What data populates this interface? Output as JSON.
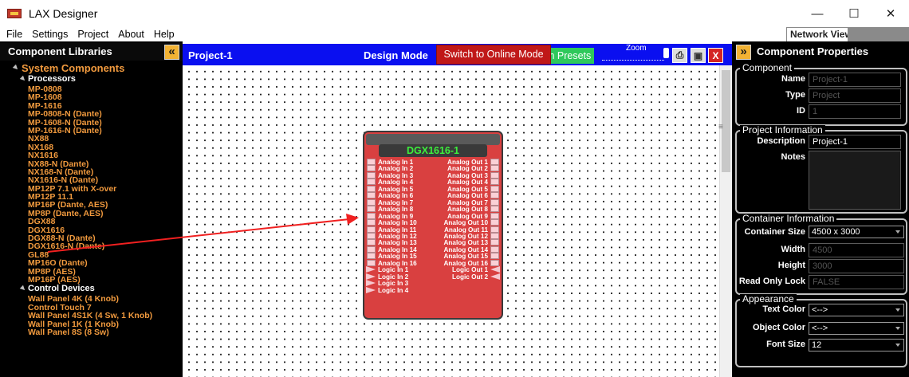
{
  "app": {
    "title": "LAX Designer"
  },
  "window_controls": {
    "minimize": "—",
    "maximize": "☐",
    "close": "✕"
  },
  "menu": [
    "File",
    "Settings",
    "Project",
    "About",
    "Help"
  ],
  "network_tab": {
    "label": "Network View"
  },
  "left_panel": {
    "title": "Component Libraries",
    "collapse_glyph": "«",
    "group": "System Components",
    "processors_label": "Processors",
    "processors": [
      "MP-0808",
      "MP-1608",
      "MP-1616",
      "MP-0808-N (Dante)",
      "MP-1608-N (Dante)",
      "MP-1616-N (Dante)",
      "NX88",
      "NX168",
      "NX1616",
      "NX88-N (Dante)",
      "NX168-N (Dante)",
      "NX1616-N (Dante)",
      "MP12P 7.1 with X-over",
      "MP12P 11.1",
      "MP16P (Dante, AES)",
      "MP8P (Dante, AES)",
      "DGX88",
      "DGX1616",
      "DGX88-N (Dante)",
      "DGX1616-N (Dante)",
      "GL88",
      "MP16O (Dante)",
      "MP8P (AES)",
      "MP16P (AES)"
    ],
    "control_label": "Control Devices",
    "control_devices": [
      "Wall Panel 4K (4 Knob)",
      "Control Touch 7",
      "Wall Panel 4S1K (4 Sw, 1 Knob)",
      "Wall Panel 1K (1 Knob)",
      "Wall Panel 8S (8 Sw)"
    ]
  },
  "design": {
    "project_name": "Project-1",
    "mode_label": "Design Mode",
    "online_button": "Switch to Online Mode",
    "presets_button": "m Presets",
    "zoom_label": "Zoom",
    "zoom_level": 1.0,
    "print_glyph": "⎙",
    "save_glyph": "▣",
    "close_glyph": "X"
  },
  "device": {
    "name": "DGX1616-1",
    "analog_in": [
      "Analog In 1",
      "Analog In 2",
      "Analog In 3",
      "Analog In 4",
      "Analog In 5",
      "Analog In 6",
      "Analog In 7",
      "Analog In 8",
      "Analog In 9",
      "Analog In 10",
      "Analog In 11",
      "Analog In 12",
      "Analog In 13",
      "Analog In 14",
      "Analog In 15",
      "Analog In 16"
    ],
    "analog_out": [
      "Analog Out 1",
      "Analog Out 2",
      "Analog Out 3",
      "Analog Out 4",
      "Analog Out 5",
      "Analog Out 6",
      "Analog Out 7",
      "Analog Out 8",
      "Analog Out 9",
      "Analog Out 10",
      "Analog Out 11",
      "Analog Out 12",
      "Analog Out 13",
      "Analog Out 14",
      "Analog Out 15",
      "Analog Out 16"
    ],
    "logic_in": [
      "Logic In 1",
      "Logic In 2",
      "Logic In 3",
      "Logic In 4"
    ],
    "logic_out": [
      "Logic Out 1",
      "Logic Out 2"
    ]
  },
  "right_panel": {
    "title": "Component Properties",
    "expand_glyph": "»",
    "component": {
      "label": "Component",
      "name_label": "Name",
      "name_value": "Project-1",
      "type_label": "Type",
      "type_value": "Project",
      "id_label": "ID",
      "id_value": "1"
    },
    "project_info": {
      "label": "Project Information",
      "description_label": "Description",
      "description_value": "Project-1",
      "notes_label": "Notes"
    },
    "container": {
      "label": "Container Information",
      "size_label": "Container Size",
      "size_value": "4500 x 3000",
      "width_label": "Width",
      "width_value": "4500",
      "height_label": "Height",
      "height_value": "3000",
      "lock_label": "Read Only Lock",
      "lock_value": "FALSE"
    },
    "appearance": {
      "label": "Appearance",
      "text_color_label": "Text Color",
      "text_color_value": "<-->",
      "object_color_label": "Object Color",
      "object_color_value": "<-->",
      "font_size_label": "Font Size",
      "font_size_value": "12"
    }
  },
  "colors": {
    "accent_orange": "#f19a3e",
    "header_blue": "#0a0ff0",
    "device_red": "#d94040",
    "online_red": "#c01818",
    "name_green": "#3cf03c",
    "annotation_arrow": "#f02020"
  }
}
